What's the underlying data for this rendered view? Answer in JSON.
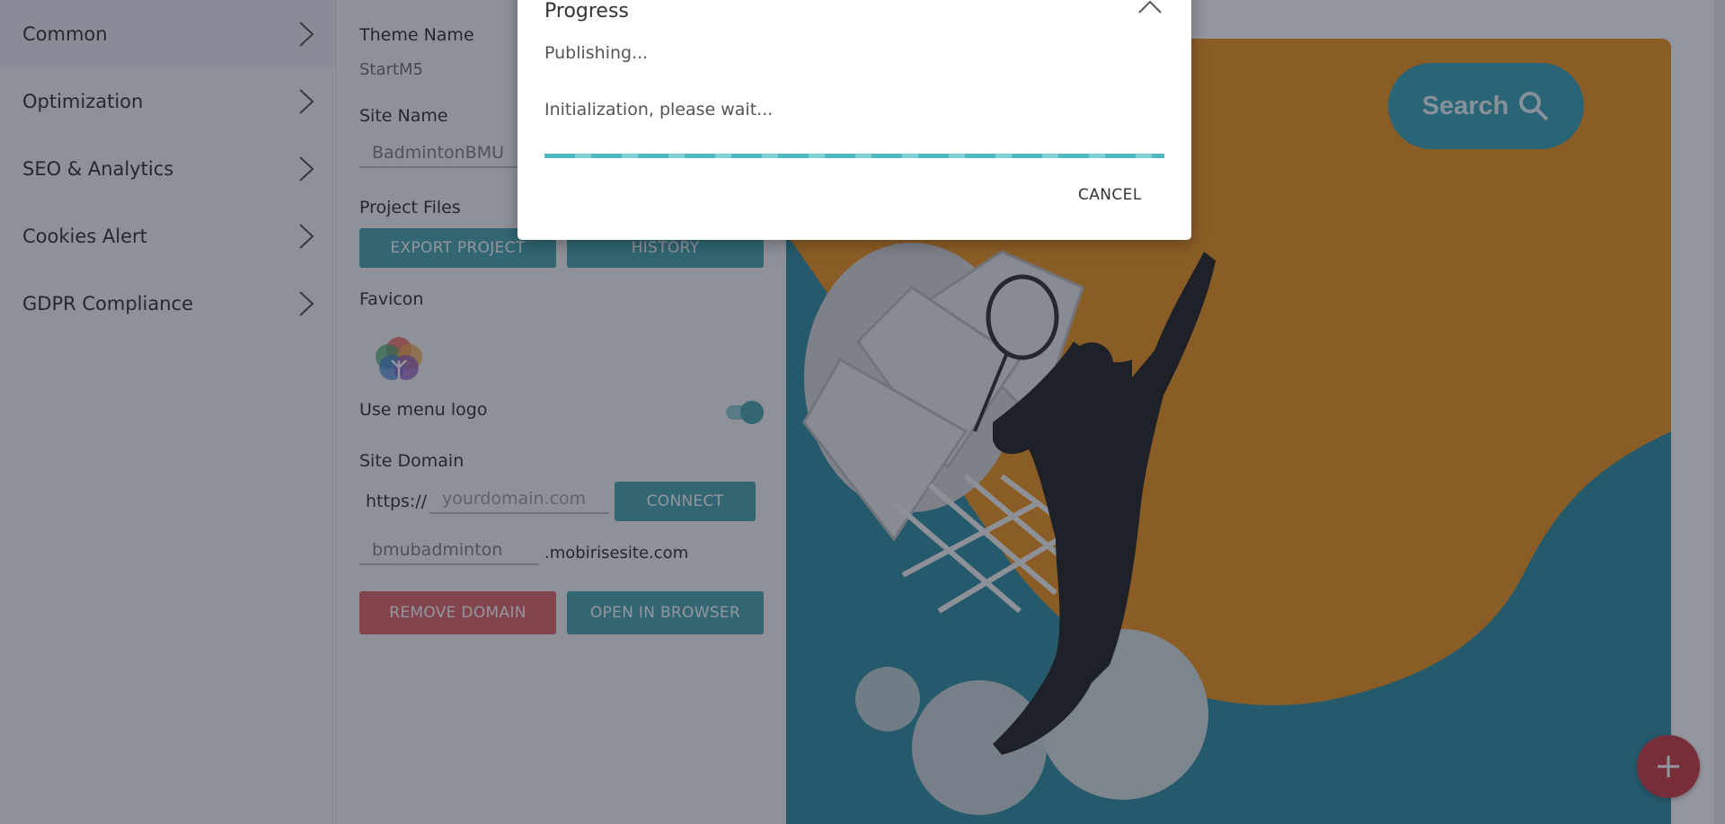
{
  "sidebar": {
    "items": [
      {
        "label": "Common",
        "active": true
      },
      {
        "label": "Optimization"
      },
      {
        "label": "SEO & Analytics"
      },
      {
        "label": "Cookies Alert"
      },
      {
        "label": "GDPR Compliance"
      }
    ]
  },
  "panel": {
    "theme_name_label": "Theme Name",
    "theme_name_value": "StartM5",
    "site_name_label": "Site Name",
    "site_name_value": "BadmintonBMU",
    "project_files_label": "Project Files",
    "export_button": "EXPORT PROJECT",
    "history_button": "HISTORY",
    "favicon_label": "Favicon",
    "menu_logo_label": "Use menu logo",
    "menu_logo_enabled": true,
    "site_domain_label": "Site Domain",
    "protocol": "https://",
    "domain_placeholder": "yourdomain.com",
    "connect_button": "CONNECT",
    "subdomain_value": "bmubadminton",
    "subdomain_suffix": ".mobirisesite.com",
    "remove_domain_button": "REMOVE DOMAIN",
    "open_browser_button": "OPEN IN BROWSER"
  },
  "preview": {
    "search_button": "Search",
    "colors": {
      "orange": "#ef8c10",
      "teal": "#22849c",
      "accent": "#2a9cb0"
    }
  },
  "fab": {
    "icon": "plus-icon",
    "color": "#c82f35"
  },
  "dialog": {
    "title": "Progress",
    "status": "Publishing...",
    "detail": "Initialization, please wait...",
    "cancel_button": "CANCEL"
  },
  "colors": {
    "teal": "#3a9ea9",
    "red": "#dd5a5e",
    "progress": "#4fb9c2"
  }
}
